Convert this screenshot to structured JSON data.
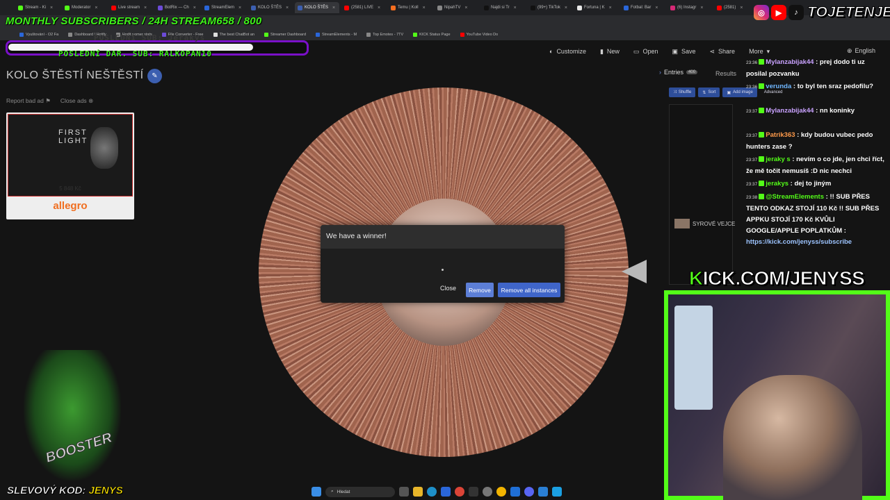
{
  "browser": {
    "tabs": [
      {
        "label": "Stream - Ki",
        "color": "#53fc18"
      },
      {
        "label": "Moderator",
        "color": "#53fc18"
      },
      {
        "label": "Live stream",
        "color": "#ff0000"
      },
      {
        "label": "BotRix — Ch",
        "color": "#6c4bd8"
      },
      {
        "label": "StreamElem",
        "color": "#2a66d9"
      },
      {
        "label": "KOLO ŠTĚS",
        "color": "#3c5fb0"
      },
      {
        "label": "KOLO ŠTĚS",
        "color": "#3c5fb0",
        "active": true
      },
      {
        "label": "(2581) LIVE",
        "color": "#ff0000"
      },
      {
        "label": "Temu | Koll",
        "color": "#f56e1f"
      },
      {
        "label": "NipahTV",
        "color": "#888888"
      },
      {
        "label": "Najdi si Tr",
        "color": "#111111"
      },
      {
        "label": "(99+) TikTok",
        "color": "#111111"
      },
      {
        "label": "Fortuna | K",
        "color": "#e8e8e8"
      },
      {
        "label": "Fotbal: Bar",
        "color": "#2a66d9"
      },
      {
        "label": "(6) Instagr",
        "color": "#d62976"
      },
      {
        "label": "(2581)",
        "color": "#ff0000"
      }
    ],
    "bookmarks": [
      {
        "label": "Vyuštování - O2 Fa",
        "color": "#2a66d9"
      },
      {
        "label": "Dashboard | Hotify",
        "color": "#888888"
      },
      {
        "label": "Hodit pomer stats",
        "color": "#888888"
      },
      {
        "label": "File Converter - Free",
        "color": "#6c4bd8"
      },
      {
        "label": "The best ChatBot an",
        "color": "#dddddd"
      },
      {
        "label": "Streamer Dashboard",
        "color": "#53fc18"
      },
      {
        "label": "StreamElements - M",
        "color": "#2a66d9"
      },
      {
        "label": "Top Emotes - 7TV",
        "color": "#888888"
      },
      {
        "label": "KICK Status Page",
        "color": "#53fc18"
      },
      {
        "label": "YouTube Video Do",
        "color": "#ff0000"
      }
    ]
  },
  "overlay": {
    "monthly": "MONTHLY SUBSCRIBERS / 24H STREAM658 / 800",
    "handle": "TOJETENJENYS",
    "last_sub": "POSLEDNÍ SUB: Jerakys",
    "last_donation": "POSLEDNÍ DAR. SUB: RALKOPAN10",
    "kick_prefix": "K",
    "kick_url": "ICK.COM/JENYSS",
    "promo_label": "SLEVOVÝ KOD: ",
    "promo_code": "JENYS",
    "booster": "BOOSTER"
  },
  "toolbar": {
    "items": [
      {
        "label": "Customize",
        "icon": "palette-icon",
        "glyph": "◐"
      },
      {
        "label": "New",
        "icon": "file-icon",
        "glyph": "▮"
      },
      {
        "label": "Open",
        "icon": "folder-icon",
        "glyph": "▭"
      },
      {
        "label": "Save",
        "icon": "save-icon",
        "glyph": "▣"
      },
      {
        "label": "Share",
        "icon": "share-icon",
        "glyph": "⋖"
      },
      {
        "label": "More",
        "icon": "more-icon",
        "glyph": "▾"
      }
    ],
    "language": "English",
    "language_glyph": "⊕"
  },
  "page": {
    "title": "KOLO ŠTĚSTÍ NEŠTĚSTÍ",
    "report_ad": "Report bad ad",
    "close_ads": "Close ads",
    "ad_price": "5 848 Kč",
    "ad_logo": "allegro",
    "ad_headline": "FIRST LIGHT"
  },
  "modal": {
    "title": "We have a winner!",
    "close": "Close",
    "remove": "Remove",
    "remove_all": "Remove all instances"
  },
  "panel": {
    "entries_label": "Entries",
    "entries_count": "400",
    "results_label": "Results",
    "shuffle": "Shuffle",
    "sort": "Sort",
    "add_image": "Add image",
    "advanced": "Advanced",
    "sample_entry": "SYROVÉ VEJCE"
  },
  "chat": [
    {
      "time": "23:36",
      "user": "Mylanzabijak44",
      "user_color": "#c9a2ff",
      "text": " : prej dodo ti uz posilal pozvanku"
    },
    {
      "time": "23:36",
      "user": "verunda",
      "user_color": "#6fb7ff",
      "text": " : to byl ten sraz pedofilu?"
    },
    {
      "time": "23:37",
      "user": "Mylanzabijak44",
      "user_color": "#c9a2ff",
      "text": " : nn koninky"
    },
    {
      "time": "23:37",
      "user": "Patrik363",
      "user_color": "#ff9a4a",
      "text": " : kdy budou vubec pedo hunters zase ?"
    },
    {
      "time": "23:37",
      "user": "jeraky s",
      "user_color": "#53fc18",
      "text": " : nevím o co jde, jen chci říct, že mě točit nemusíš :D nic nechci"
    },
    {
      "time": "23:37",
      "user": "jerakys",
      "user_color": "#53fc18",
      "text": " : dej to jiným"
    },
    {
      "time": "23:38",
      "user": "@StreamElements",
      "user_color": "#53fc18",
      "text": " : !! SUB PŘES TENTO ODKAZ STOJÍ 110 Kč !! SUB PŘES APPKU STOJÍ 170 Kč KVŮLI GOOGLE/APPLE POPLATKŮM :",
      "link": "https://kick.com/jenyss/subscribe"
    }
  ],
  "taskbar": {
    "search_placeholder": "Hledat"
  },
  "colors": {
    "kick_green": "#53fc18",
    "accent_blue": "#3f65c9",
    "sub_purple": "#7a10c8"
  }
}
